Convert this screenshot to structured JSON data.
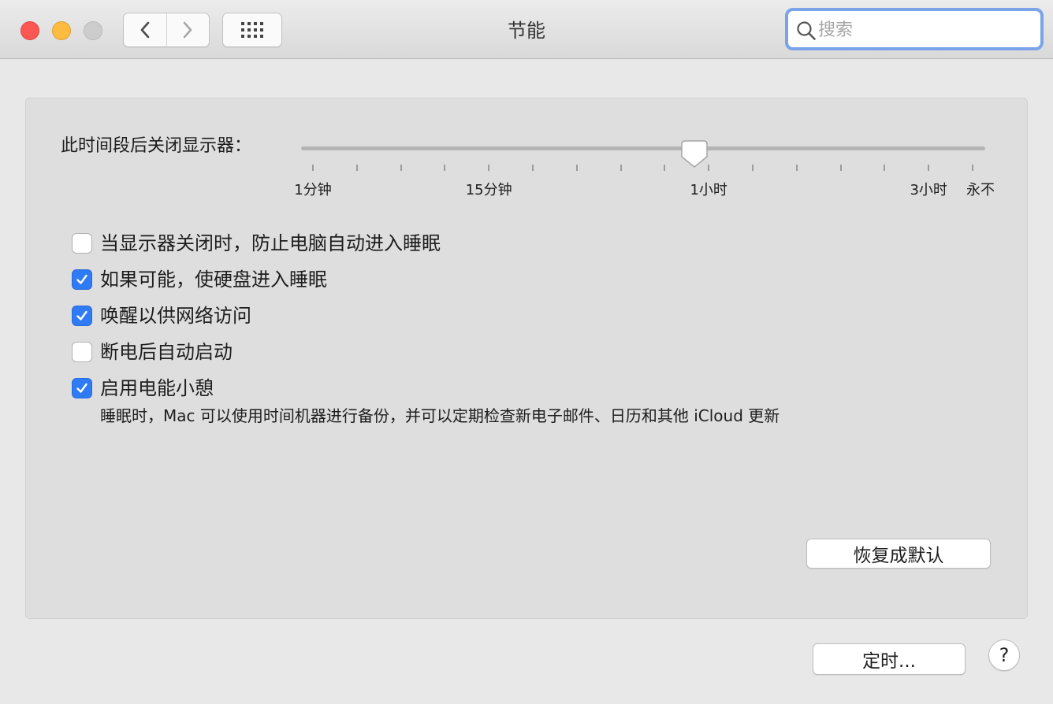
{
  "window": {
    "title": "节能",
    "search_placeholder": "搜索"
  },
  "display_sleep": {
    "label": "此时间段后关闭显示器：",
    "selected": "1小时",
    "tick_labels": [
      {
        "text": "1分钟",
        "tick": 0
      },
      {
        "text": "15分钟",
        "tick": 4
      },
      {
        "text": "1小时",
        "tick": 9
      },
      {
        "text": "3小时",
        "tick": 14
      },
      {
        "text": "永不",
        "tick": 15
      }
    ]
  },
  "options": [
    {
      "label": "当显示器关闭时，防止电脑自动进入睡眠",
      "checked": false
    },
    {
      "label": "如果可能，使硬盘进入睡眠",
      "checked": true
    },
    {
      "label": "唤醒以供网络访问",
      "checked": true
    },
    {
      "label": "断电后自动启动",
      "checked": false
    },
    {
      "label": "启用电能小憩",
      "checked": true
    }
  ],
  "power_nap_description": "睡眠时，Mac 可以使用时间机器进行备份，并可以定期检查新电子邮件、日历和其他 iCloud 更新",
  "buttons": {
    "restore_defaults": "恢复成默认",
    "schedule": "定时...",
    "help": "?"
  },
  "colors": {
    "accent": "#2f7bf5",
    "close": "#fc5753",
    "minimize": "#fdbc40",
    "zoom": "#cdcdcd"
  }
}
